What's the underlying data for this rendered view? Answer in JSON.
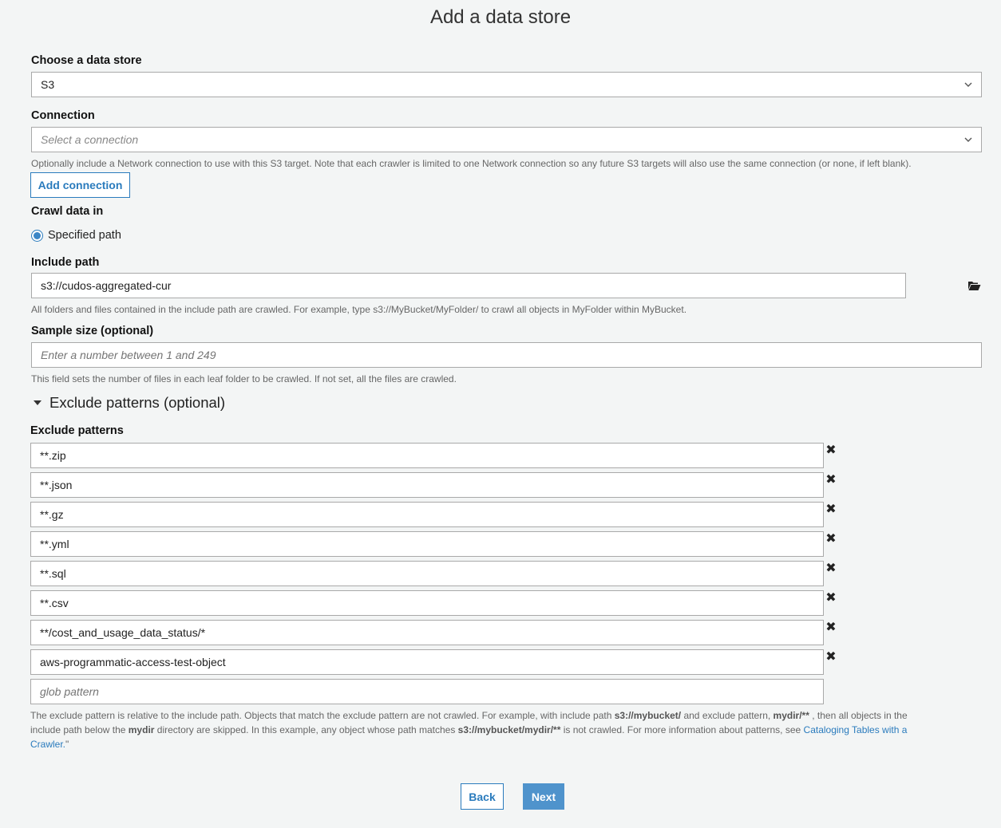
{
  "page": {
    "title": "Add a data store"
  },
  "data_store": {
    "label": "Choose a data store",
    "value": "S3"
  },
  "connection": {
    "label": "Connection",
    "placeholder": "Select a connection",
    "help": "Optionally include a Network connection to use with this S3 target. Note that each crawler is limited to one Network connection so any future S3 targets will also use the same connection (or none, if left blank).",
    "add_button": "Add connection"
  },
  "crawl": {
    "label": "Crawl data in",
    "option": "Specified path",
    "selected": true
  },
  "include_path": {
    "label": "Include path",
    "value": "s3://cudos-aggregated-cur",
    "help": "All folders and files contained in the include path are crawled. For example, type s3://MyBucket/MyFolder/ to crawl all objects in MyFolder within MyBucket."
  },
  "sample_size": {
    "label": "Sample size (optional)",
    "placeholder": "Enter a number between 1 and 249",
    "help": "This field sets the number of files in each leaf folder to be crawled. If not set, all the files are crawled."
  },
  "exclude": {
    "section_title": "Exclude patterns (optional)",
    "label": "Exclude patterns",
    "patterns": [
      "**.zip",
      "**.json",
      "**.gz",
      "**.yml",
      "**.sql",
      "**.csv",
      "**/cost_and_usage_data_status/*",
      "aws-programmatic-access-test-object"
    ],
    "new_placeholder": "glob pattern",
    "help": {
      "t1": "The exclude pattern is relative to the include path. Objects that match the exclude pattern are not crawled. For example, with include path ",
      "b1": "s3://mybucket/",
      "t2": " and exclude pattern, ",
      "b2": "mydir/**",
      "t3": " , then all objects in the include path below the ",
      "b3": "mydir",
      "t4": " directory are skipped. In this example, any object whose path matches ",
      "b4": "s3://mybucket/mydir/**",
      "t5": " is not crawled. For more information about patterns, see ",
      "link": "Cataloging Tables with a Crawler.",
      "t6": "\""
    }
  },
  "footer": {
    "back": "Back",
    "next": "Next"
  },
  "colors": {
    "accent": "#2a7bbd",
    "primary_button": "#4f93cc",
    "background": "#f3f5f5"
  }
}
